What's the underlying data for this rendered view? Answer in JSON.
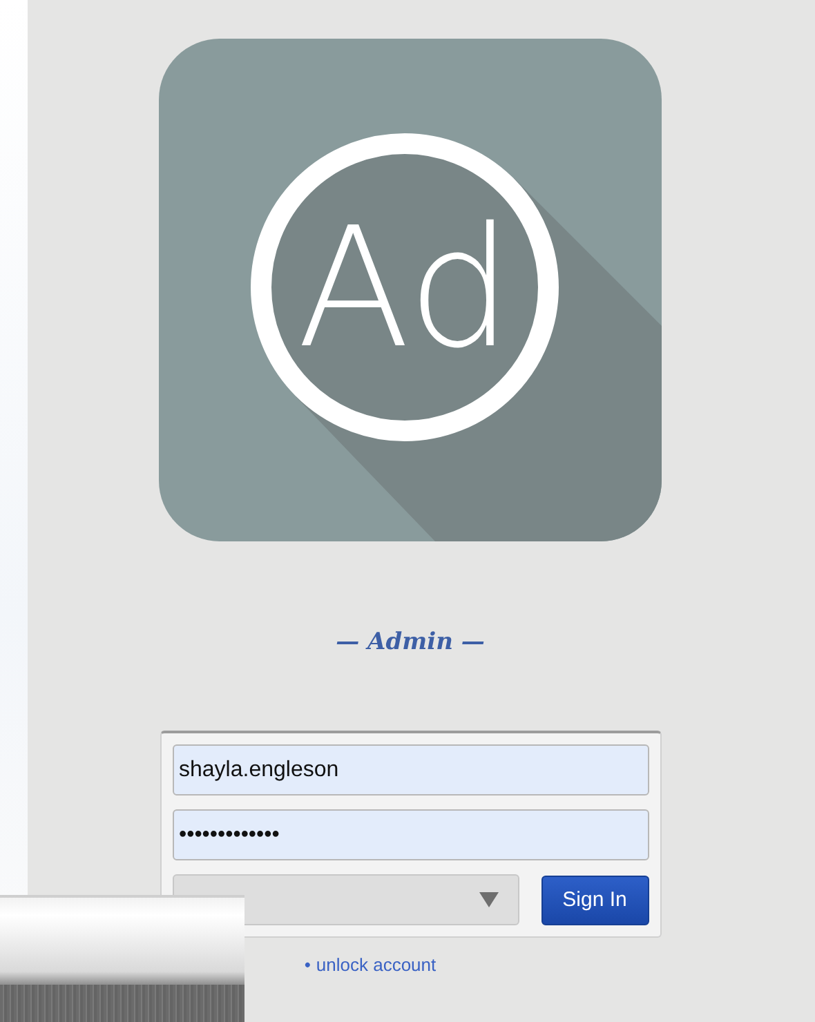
{
  "logo": {
    "text": "Ad"
  },
  "heading": "— Admin —",
  "login_form": {
    "username": "shayla.engleson",
    "password": "•••••••••••••",
    "submit": "Sign In"
  },
  "links": [
    {
      "bullet": "•",
      "label": "unlock account"
    }
  ]
}
